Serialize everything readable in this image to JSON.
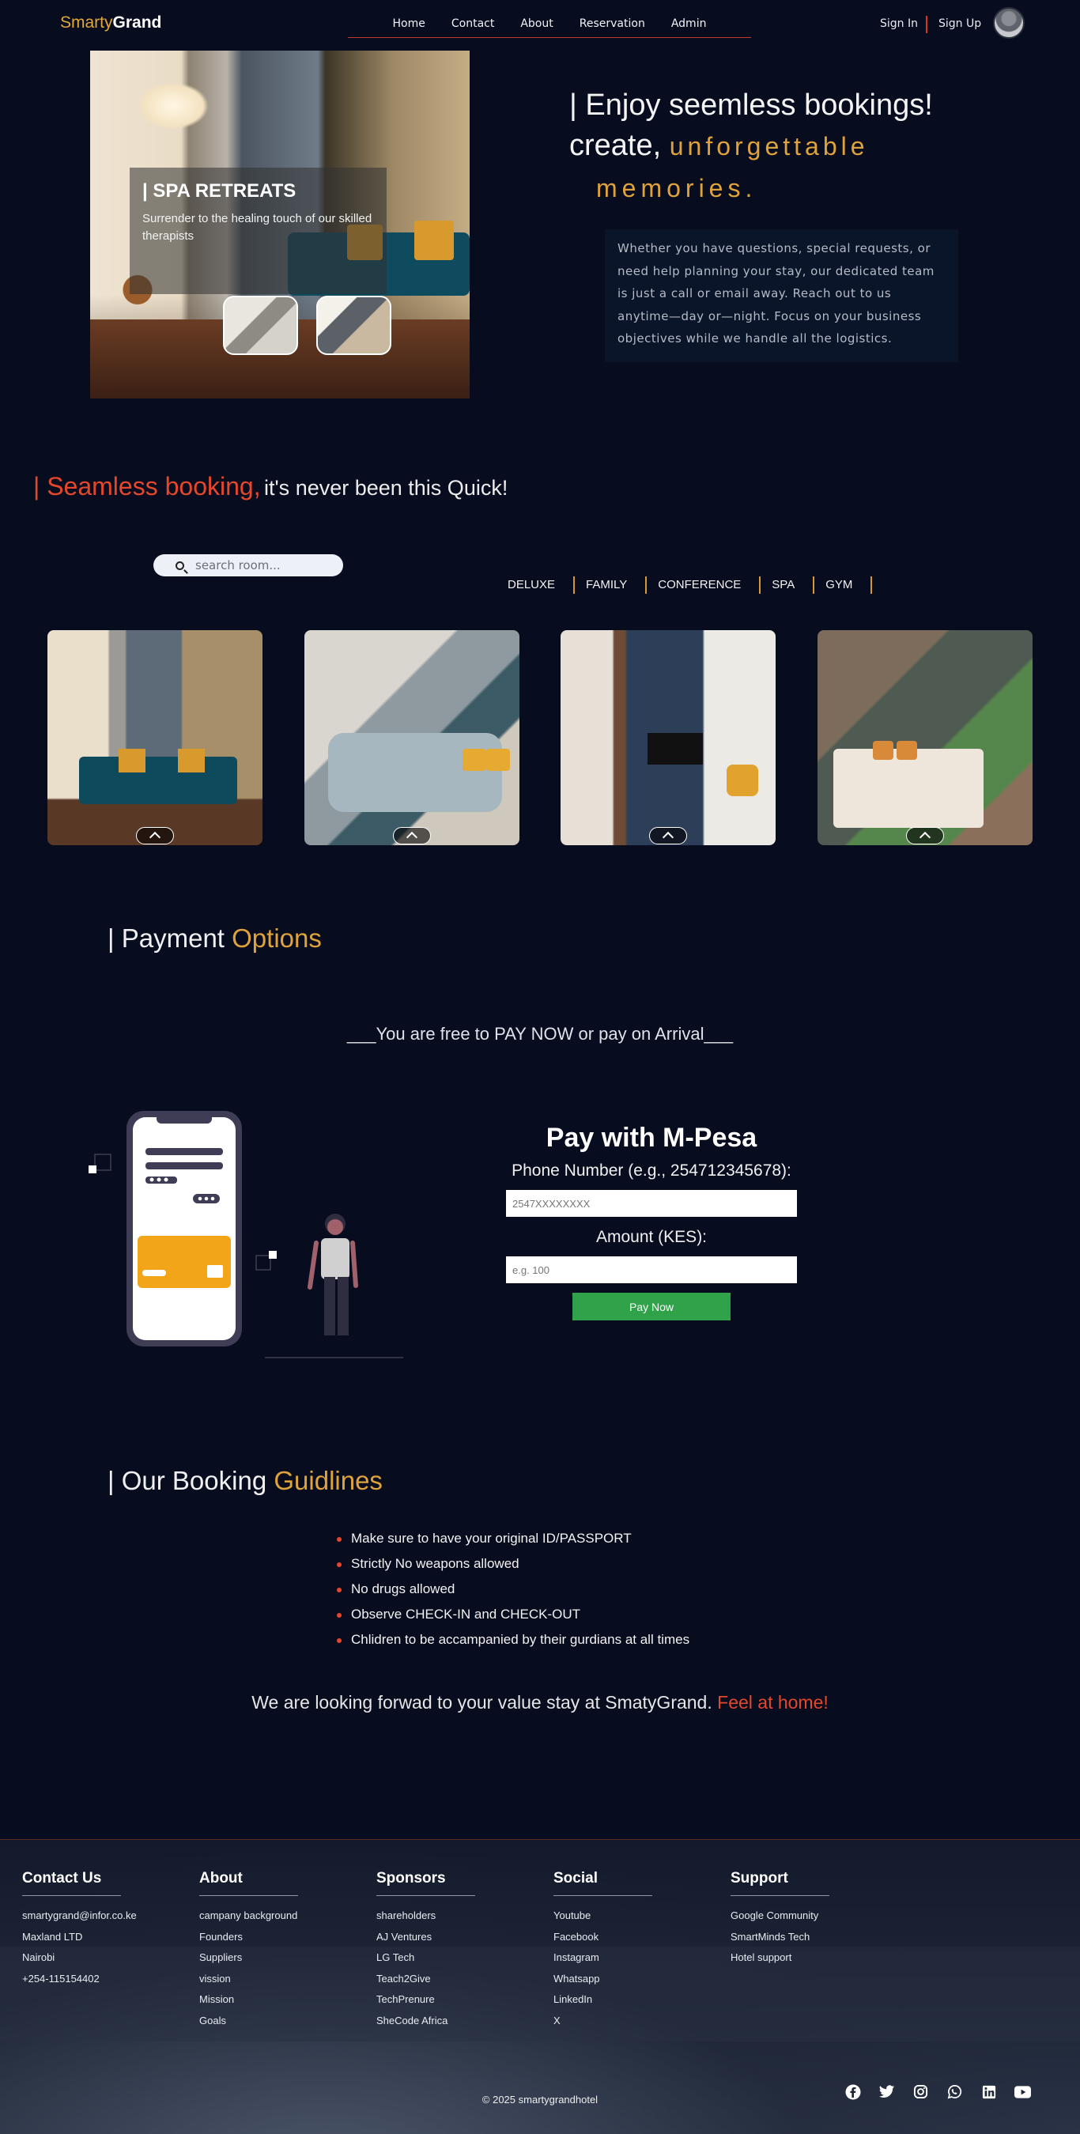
{
  "nav": {
    "logo_part1": "Smarty",
    "logo_part2": "Grand",
    "links": [
      "Home",
      "Contact",
      "About",
      "Reservation",
      "Admin"
    ],
    "sign_in": "Sign In",
    "sign_up": "Sign Up"
  },
  "hero": {
    "card_title": "| SPA RETREATS",
    "card_text": "Surrender to the healing touch of our skilled therapists",
    "title_line1": "| Enjoy seemless bookings!",
    "title_line2_prefix": "create,",
    "title_line2_gold": "unforgettable",
    "title_line3_gold": "memories.",
    "description": "Whether you have questions, special requests, or need help planning your stay, our dedicated team is just a call or email away. Reach out to us anytime—day or—night. Focus on your business objectives while we handle all the logistics."
  },
  "booking": {
    "title_red": "| Seamless booking,",
    "title_rest": "it's never been this Quick!",
    "search_placeholder": "search room...",
    "categories": [
      "DELUXE",
      "FAMILY",
      "CONFERENCE",
      "SPA",
      "GYM"
    ]
  },
  "payment": {
    "title_prefix": "| Payment",
    "title_gold": "Options",
    "subtitle": "___You are free to PAY NOW or pay on Arrival___",
    "form_title": "Pay with M-Pesa",
    "phone_label": "Phone Number (e.g., 254712345678):",
    "phone_placeholder": "2547XXXXXXXX",
    "amount_label": "Amount (KES):",
    "amount_placeholder": "e.g. 100",
    "button": "Pay Now"
  },
  "guidelines": {
    "title_prefix": "| Our Booking",
    "title_gold": "Guidlines",
    "items": [
      "Make sure to have your original ID/PASSPORT",
      "Strictly No weapons allowed",
      "No drugs allowed",
      "Observe CHECK-IN and CHECK-OUT",
      "Chlidren to be accampanied by their gurdians at all times"
    ],
    "closing_text": "We are looking forwad to your value stay at SmatyGrand.",
    "closing_red": "Feel at home!"
  },
  "footer": {
    "columns": [
      {
        "title": "Contact Us",
        "items": [
          "smartygrand@infor.co.ke",
          "Maxland LTD",
          "Nairobi",
          "+254-115154402"
        ]
      },
      {
        "title": "About",
        "items": [
          "campany background",
          "Founders",
          "Suppliers",
          "vission",
          "Mission",
          "Goals"
        ]
      },
      {
        "title": "Sponsors",
        "items": [
          "shareholders",
          "AJ Ventures",
          "LG Tech",
          "Teach2Give",
          "TechPrenure",
          "SheCode Africa"
        ]
      },
      {
        "title": "Social",
        "items": [
          "Youtube",
          "Facebook",
          "Instagram",
          "Whatsapp",
          "LinkedIn",
          "X"
        ]
      },
      {
        "title": "Support",
        "items": [
          "Google Community",
          "SmartMinds Tech",
          "Hotel support"
        ]
      }
    ],
    "social_icons": [
      "facebook-icon",
      "twitter-icon",
      "instagram-icon",
      "whatsapp-icon",
      "linkedin-icon",
      "youtube-icon"
    ],
    "copyright": "© 2025 smartygrandhotel"
  },
  "colors": {
    "background": "#070d1f",
    "accent_gold": "#e0a33b",
    "accent_red": "#e5472c",
    "pay_button": "#2fa24a"
  }
}
